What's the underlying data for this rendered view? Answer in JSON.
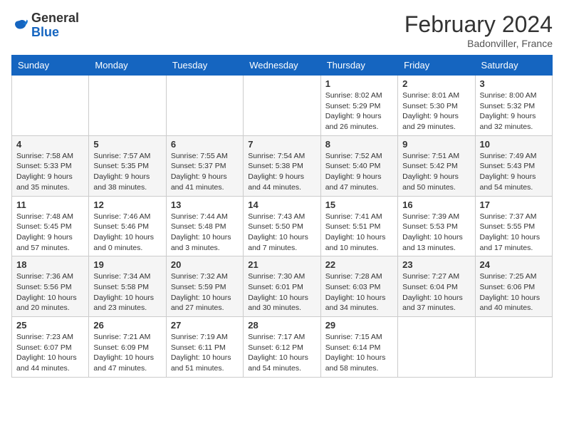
{
  "header": {
    "logo_general": "General",
    "logo_blue": "Blue",
    "month_title": "February 2024",
    "location": "Badonviller, France"
  },
  "days_of_week": [
    "Sunday",
    "Monday",
    "Tuesday",
    "Wednesday",
    "Thursday",
    "Friday",
    "Saturday"
  ],
  "weeks": [
    [
      {
        "day": "",
        "info": ""
      },
      {
        "day": "",
        "info": ""
      },
      {
        "day": "",
        "info": ""
      },
      {
        "day": "",
        "info": ""
      },
      {
        "day": "1",
        "info": "Sunrise: 8:02 AM\nSunset: 5:29 PM\nDaylight: 9 hours\nand 26 minutes."
      },
      {
        "day": "2",
        "info": "Sunrise: 8:01 AM\nSunset: 5:30 PM\nDaylight: 9 hours\nand 29 minutes."
      },
      {
        "day": "3",
        "info": "Sunrise: 8:00 AM\nSunset: 5:32 PM\nDaylight: 9 hours\nand 32 minutes."
      }
    ],
    [
      {
        "day": "4",
        "info": "Sunrise: 7:58 AM\nSunset: 5:33 PM\nDaylight: 9 hours\nand 35 minutes."
      },
      {
        "day": "5",
        "info": "Sunrise: 7:57 AM\nSunset: 5:35 PM\nDaylight: 9 hours\nand 38 minutes."
      },
      {
        "day": "6",
        "info": "Sunrise: 7:55 AM\nSunset: 5:37 PM\nDaylight: 9 hours\nand 41 minutes."
      },
      {
        "day": "7",
        "info": "Sunrise: 7:54 AM\nSunset: 5:38 PM\nDaylight: 9 hours\nand 44 minutes."
      },
      {
        "day": "8",
        "info": "Sunrise: 7:52 AM\nSunset: 5:40 PM\nDaylight: 9 hours\nand 47 minutes."
      },
      {
        "day": "9",
        "info": "Sunrise: 7:51 AM\nSunset: 5:42 PM\nDaylight: 9 hours\nand 50 minutes."
      },
      {
        "day": "10",
        "info": "Sunrise: 7:49 AM\nSunset: 5:43 PM\nDaylight: 9 hours\nand 54 minutes."
      }
    ],
    [
      {
        "day": "11",
        "info": "Sunrise: 7:48 AM\nSunset: 5:45 PM\nDaylight: 9 hours\nand 57 minutes."
      },
      {
        "day": "12",
        "info": "Sunrise: 7:46 AM\nSunset: 5:46 PM\nDaylight: 10 hours\nand 0 minutes."
      },
      {
        "day": "13",
        "info": "Sunrise: 7:44 AM\nSunset: 5:48 PM\nDaylight: 10 hours\nand 3 minutes."
      },
      {
        "day": "14",
        "info": "Sunrise: 7:43 AM\nSunset: 5:50 PM\nDaylight: 10 hours\nand 7 minutes."
      },
      {
        "day": "15",
        "info": "Sunrise: 7:41 AM\nSunset: 5:51 PM\nDaylight: 10 hours\nand 10 minutes."
      },
      {
        "day": "16",
        "info": "Sunrise: 7:39 AM\nSunset: 5:53 PM\nDaylight: 10 hours\nand 13 minutes."
      },
      {
        "day": "17",
        "info": "Sunrise: 7:37 AM\nSunset: 5:55 PM\nDaylight: 10 hours\nand 17 minutes."
      }
    ],
    [
      {
        "day": "18",
        "info": "Sunrise: 7:36 AM\nSunset: 5:56 PM\nDaylight: 10 hours\nand 20 minutes."
      },
      {
        "day": "19",
        "info": "Sunrise: 7:34 AM\nSunset: 5:58 PM\nDaylight: 10 hours\nand 23 minutes."
      },
      {
        "day": "20",
        "info": "Sunrise: 7:32 AM\nSunset: 5:59 PM\nDaylight: 10 hours\nand 27 minutes."
      },
      {
        "day": "21",
        "info": "Sunrise: 7:30 AM\nSunset: 6:01 PM\nDaylight: 10 hours\nand 30 minutes."
      },
      {
        "day": "22",
        "info": "Sunrise: 7:28 AM\nSunset: 6:03 PM\nDaylight: 10 hours\nand 34 minutes."
      },
      {
        "day": "23",
        "info": "Sunrise: 7:27 AM\nSunset: 6:04 PM\nDaylight: 10 hours\nand 37 minutes."
      },
      {
        "day": "24",
        "info": "Sunrise: 7:25 AM\nSunset: 6:06 PM\nDaylight: 10 hours\nand 40 minutes."
      }
    ],
    [
      {
        "day": "25",
        "info": "Sunrise: 7:23 AM\nSunset: 6:07 PM\nDaylight: 10 hours\nand 44 minutes."
      },
      {
        "day": "26",
        "info": "Sunrise: 7:21 AM\nSunset: 6:09 PM\nDaylight: 10 hours\nand 47 minutes."
      },
      {
        "day": "27",
        "info": "Sunrise: 7:19 AM\nSunset: 6:11 PM\nDaylight: 10 hours\nand 51 minutes."
      },
      {
        "day": "28",
        "info": "Sunrise: 7:17 AM\nSunset: 6:12 PM\nDaylight: 10 hours\nand 54 minutes."
      },
      {
        "day": "29",
        "info": "Sunrise: 7:15 AM\nSunset: 6:14 PM\nDaylight: 10 hours\nand 58 minutes."
      },
      {
        "day": "",
        "info": ""
      },
      {
        "day": "",
        "info": ""
      }
    ]
  ]
}
